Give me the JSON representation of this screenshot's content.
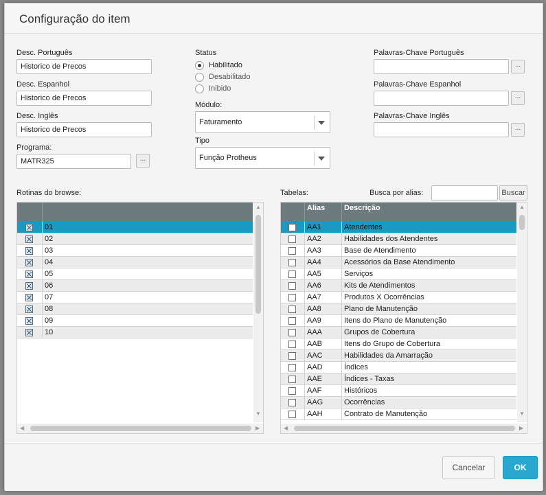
{
  "dialog": {
    "title": "Configuração do item"
  },
  "fields": {
    "desc_pt": {
      "label": "Desc. Português",
      "value": "Historico de Precos"
    },
    "desc_es": {
      "label": "Desc. Espanhol",
      "value": "Historico de Precos"
    },
    "desc_en": {
      "label": "Desc. Inglês",
      "value": "Historico de Precos"
    },
    "programa": {
      "label": "Programa:",
      "value": "MATR325",
      "lookup_label": "..."
    }
  },
  "status": {
    "label": "Status",
    "options": [
      {
        "label": "Habilitado",
        "selected": true
      },
      {
        "label": "Desabilitado",
        "selected": false
      },
      {
        "label": "Inibido",
        "selected": false
      }
    ]
  },
  "modulo": {
    "label": "Módulo:",
    "value": "Faturamento"
  },
  "tipo": {
    "label": "Tipo",
    "value": "Função Protheus"
  },
  "keywords": {
    "pt": {
      "label": "Palavras-Chave Português",
      "value": "",
      "lookup_label": "..."
    },
    "es": {
      "label": "Palavras-Chave Espanhol",
      "value": "",
      "lookup_label": "..."
    },
    "en": {
      "label": "Palavras-Chave Inglês",
      "value": "",
      "lookup_label": "..."
    }
  },
  "routines": {
    "label": "Rotinas do browse:",
    "rows": [
      {
        "checked": true,
        "value": "01"
      },
      {
        "checked": true,
        "value": "02"
      },
      {
        "checked": true,
        "value": "03"
      },
      {
        "checked": true,
        "value": "04"
      },
      {
        "checked": true,
        "value": "05"
      },
      {
        "checked": true,
        "value": "06"
      },
      {
        "checked": true,
        "value": "07"
      },
      {
        "checked": true,
        "value": "08"
      },
      {
        "checked": true,
        "value": "09"
      },
      {
        "checked": true,
        "value": "10"
      }
    ],
    "selected_index": 0
  },
  "tables": {
    "label": "Tabelas:",
    "search_label": "Busca por alias:",
    "search_value": "",
    "search_button": "Buscar",
    "columns": [
      "Alias",
      "Descrição"
    ],
    "rows": [
      {
        "alias": "AA1",
        "desc": "Atendentes"
      },
      {
        "alias": "AA2",
        "desc": "Habilidades dos Atendentes"
      },
      {
        "alias": "AA3",
        "desc": "Base de Atendimento"
      },
      {
        "alias": "AA4",
        "desc": "Acessórios da Base Atendimento"
      },
      {
        "alias": "AA5",
        "desc": "Serviços"
      },
      {
        "alias": "AA6",
        "desc": "Kits de Atendimentos"
      },
      {
        "alias": "AA7",
        "desc": "Produtos X Ocorrências"
      },
      {
        "alias": "AA8",
        "desc": "Plano de Manutenção"
      },
      {
        "alias": "AA9",
        "desc": "Itens do Plano de Manutenção"
      },
      {
        "alias": "AAA",
        "desc": "Grupos de Cobertura"
      },
      {
        "alias": "AAB",
        "desc": "Itens do Grupo de Cobertura"
      },
      {
        "alias": "AAC",
        "desc": "Habilidades da Amarração"
      },
      {
        "alias": "AAD",
        "desc": "Índices"
      },
      {
        "alias": "AAE",
        "desc": "Índices - Taxas"
      },
      {
        "alias": "AAF",
        "desc": "Históricos"
      },
      {
        "alias": "AAG",
        "desc": "Ocorrências"
      },
      {
        "alias": "AAH",
        "desc": "Contrato de Manutenção"
      }
    ],
    "selected_index": 0
  },
  "footer": {
    "cancel_label": "Cancelar",
    "ok_label": "OK"
  },
  "colors": {
    "accent": "#29a7cf",
    "selected_row": "#1a9ac2",
    "grid_header": "#6d7a7e"
  }
}
